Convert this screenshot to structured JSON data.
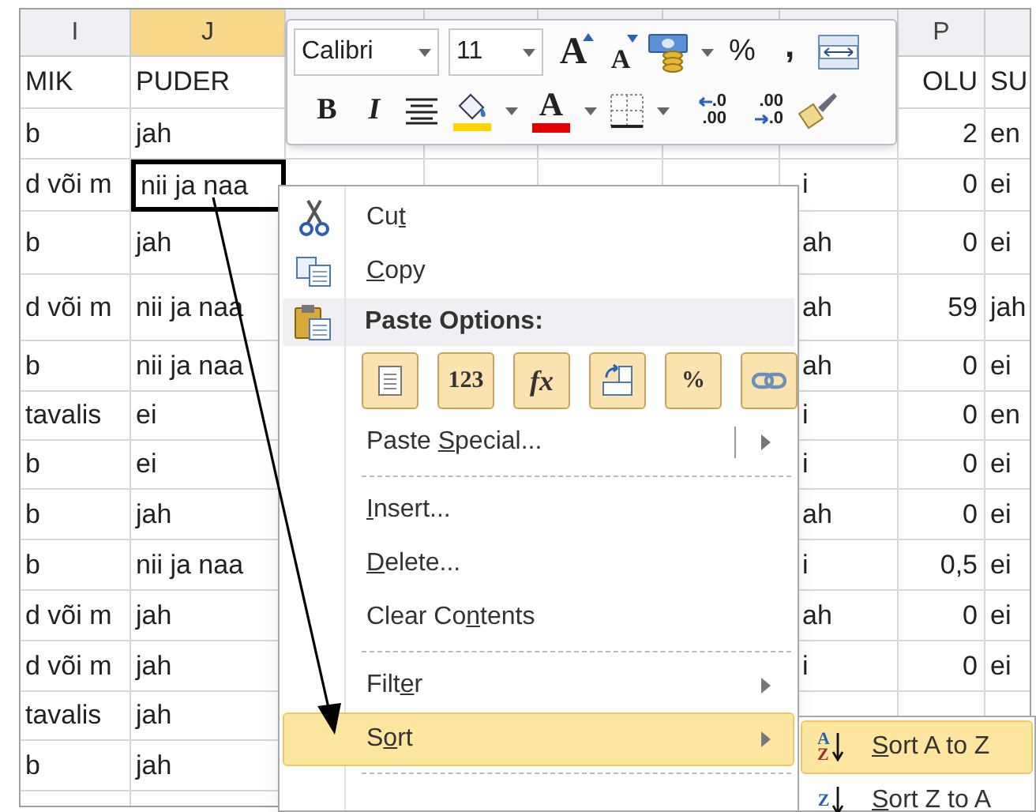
{
  "columns": [
    {
      "kind": "text",
      "letter": "I",
      "selected": false
    },
    {
      "kind": "text",
      "letter": "J",
      "selected": true
    },
    {
      "kind": "covered"
    },
    {
      "kind": "covered"
    },
    {
      "kind": "covered"
    },
    {
      "kind": "covered"
    },
    {
      "kind": "covered"
    },
    {
      "kind": "number",
      "letter": "P",
      "selected": false
    },
    {
      "kind": "text"
    }
  ],
  "rows": [
    {
      "selected": false,
      "cells": {
        "I": "MIK",
        "J": "PUDER",
        "P": "OLU",
        "Q": "SU"
      }
    },
    {
      "selected": false,
      "cells": {
        "I": "b",
        "J": "jah",
        "P": "2",
        "Q": "en"
      }
    },
    {
      "selected": true,
      "cells": {
        "I": "d või m",
        "J": "nii ja naa",
        "O": "i",
        "P": "0",
        "Q": "ei"
      }
    },
    {
      "selected": false,
      "cells": {
        "I": "b",
        "J": "jah",
        "O": "ah",
        "P": "0",
        "Q": "ei"
      }
    },
    {
      "selected": false,
      "cells": {
        "I": "d või m",
        "J": "nii ja naa",
        "O": "ah",
        "P": "59",
        "Q": "jah"
      }
    },
    {
      "selected": false,
      "cells": {
        "I": "b",
        "J": "nii ja naa",
        "O": "ah",
        "P": "0",
        "Q": "ei"
      }
    },
    {
      "selected": false,
      "cells": {
        "I": "tavalis",
        "J": "ei",
        "O": "i",
        "P": "0",
        "Q": "en"
      }
    },
    {
      "selected": false,
      "cells": {
        "I": "b",
        "J": "ei",
        "O": "i",
        "P": "0",
        "Q": "ei"
      }
    },
    {
      "selected": false,
      "cells": {
        "I": "b",
        "J": "jah",
        "O": "ah",
        "P": "0",
        "Q": "ei"
      }
    },
    {
      "selected": false,
      "cells": {
        "I": "b",
        "J": "nii ja naa",
        "O": "i",
        "P": "0,5",
        "Q": "ei"
      }
    },
    {
      "selected": false,
      "cells": {
        "I": "d või m",
        "J": "jah",
        "O": "ah",
        "P": "0",
        "Q": "ei"
      }
    },
    {
      "selected": false,
      "cells": {
        "I": "d või m",
        "J": "jah",
        "O": "i",
        "P": "0",
        "Q": "ei"
      }
    },
    {
      "selected": false,
      "cells": {
        "I": "tavalis",
        "J": "jah"
      }
    },
    {
      "selected": false,
      "cells": {
        "I": "b",
        "J": "jah"
      }
    }
  ],
  "mini_toolbar": {
    "font_name": "Calibri",
    "font_size": "11",
    "grow_font": "A",
    "shrink_font": "A",
    "percent": "%",
    "comma": ",",
    "bold": "B",
    "italic": "I",
    "font_color": "A",
    "increase_decimal": [
      ".0",
      ".00"
    ],
    "decrease_decimal": [
      ".00",
      ".0"
    ]
  },
  "context_menu": [
    {
      "kind": "command",
      "before": "Cu",
      "key": "t",
      "submenu": false,
      "selected": false
    },
    {
      "kind": "command",
      "key": "C",
      "after": "opy",
      "submenu": false,
      "selected": false
    },
    {
      "kind": "header",
      "label": "Paste Options:"
    },
    {
      "kind": "paste_icons",
      "options": [
        {
          "kind": "keep_source"
        },
        {
          "kind": "values",
          "glyph": "123"
        },
        {
          "kind": "formulas",
          "glyph": "fx"
        },
        {
          "kind": "transpose"
        },
        {
          "kind": "formatting",
          "glyph": "%"
        },
        {
          "kind": "link"
        }
      ]
    },
    {
      "kind": "command",
      "before": "Paste ",
      "key": "S",
      "after": "pecial...",
      "submenu": true,
      "selected": false
    },
    {
      "kind": "separator"
    },
    {
      "kind": "command",
      "key": "I",
      "after": "nsert...",
      "submenu": false,
      "selected": false
    },
    {
      "kind": "command",
      "key": "D",
      "after": "elete...",
      "submenu": false,
      "selected": false
    },
    {
      "kind": "command",
      "before": "Clear Co",
      "key": "n",
      "after": "tents",
      "submenu": false,
      "selected": false
    },
    {
      "kind": "separator"
    },
    {
      "kind": "command",
      "before": "Filt",
      "key": "e",
      "after": "r",
      "submenu": true,
      "selected": false
    },
    {
      "kind": "command",
      "before": "S",
      "key": "o",
      "after": "rt",
      "submenu": true,
      "selected": true
    },
    {
      "kind": "separator"
    }
  ],
  "submenu": [
    {
      "glyph_top": "A",
      "glyph_bottom": "Z",
      "key": "S",
      "after": "ort A to Z",
      "selected": true
    },
    {
      "glyph_top": "Z",
      "key": "S",
      "after": "ort Z to A",
      "selected": false
    }
  ]
}
